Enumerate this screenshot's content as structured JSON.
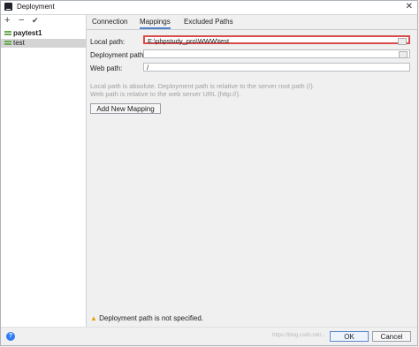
{
  "window": {
    "title": "Deployment"
  },
  "left": {
    "toolbar": {
      "add": "+",
      "remove": "−",
      "check": "✔"
    },
    "items": [
      {
        "label": "paytest1",
        "bold": true,
        "selected": false
      },
      {
        "label": "test",
        "bold": false,
        "selected": true
      }
    ]
  },
  "tabs": [
    {
      "label": "Connection"
    },
    {
      "label": "Mappings"
    },
    {
      "label": "Excluded Paths"
    }
  ],
  "mappings": {
    "local_label": "Local path:",
    "local_value": "E:\\phpstudy_pro\\WWW\\test",
    "deploy_label": "Deployment path:",
    "deploy_value": "",
    "web_label": "Web path:",
    "web_value": "/",
    "help1": "Local path is absolute. Deployment path is relative to the server root path (/).",
    "help2": "Web path is relative to the web server URL (http://).",
    "add_button": "Add New Mapping"
  },
  "warning": "Deployment path is not specified.",
  "footer": {
    "help": "?",
    "ok": "OK",
    "cancel": "Cancel",
    "watermark": "https://blog.csdn.net/..."
  }
}
